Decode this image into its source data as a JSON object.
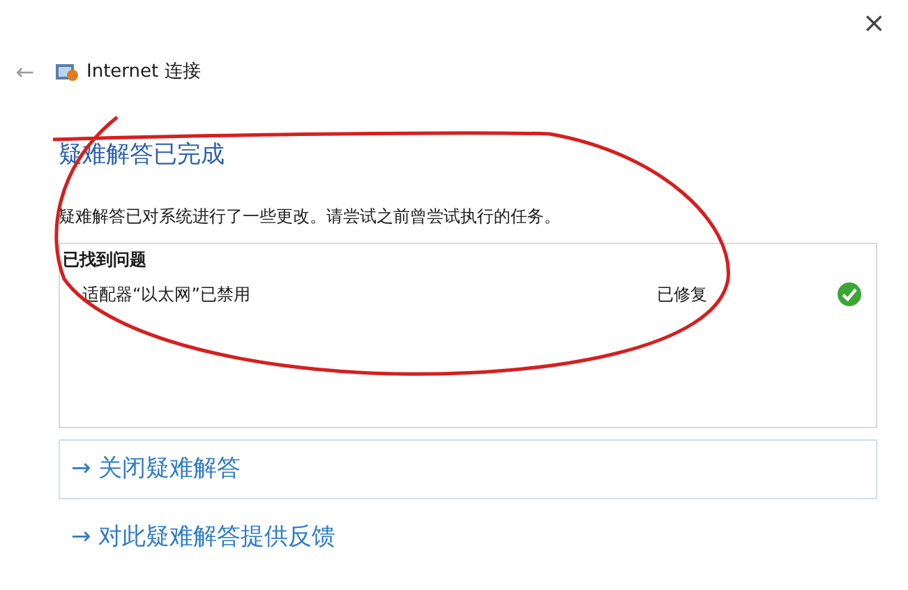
{
  "window": {
    "title": "Internet 连接",
    "close": "×",
    "back": "←"
  },
  "heading": "疑难解答已完成",
  "description": "疑难解答已对系统进行了一些更改。请尝试之前曾尝试执行的任务。",
  "problems": {
    "title": "已找到问题",
    "items": [
      {
        "name": "适配器“以太网”已禁用",
        "status": "已修复",
        "fixed": true
      }
    ]
  },
  "actions": [
    {
      "arrow": "→",
      "label": "关闭疑难解答",
      "boxed": true
    },
    {
      "arrow": "→",
      "label": "对此疑难解答提供反馈",
      "boxed": false
    }
  ]
}
